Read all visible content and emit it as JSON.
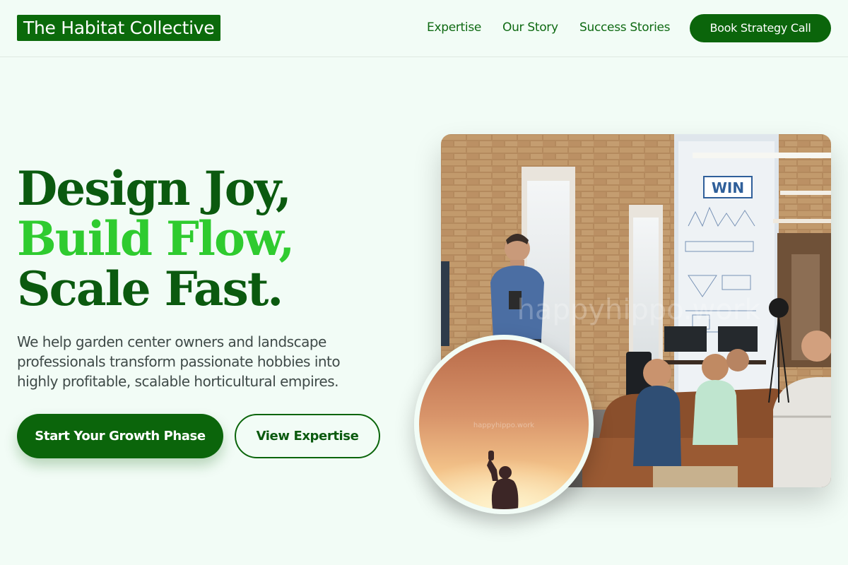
{
  "header": {
    "logo": "The Habitat Collective",
    "nav": [
      "Expertise",
      "Our Story",
      "Success Stories"
    ],
    "cta": "Book Strategy Call"
  },
  "hero": {
    "headline": [
      "Design Joy,",
      "Build Flow,",
      "Scale Fast."
    ],
    "subtext": "We help garden center owners and landscape professionals transform passionate hobbies into highly profitable, scalable horticultural empires.",
    "primary_button": "Start Your Growth Phase",
    "secondary_button": "View Expertise"
  },
  "images": {
    "main": "photo of a man presenting to a group seated on a leather couch in a brick-walled office",
    "circle": "photo of a silhouetted person raising a fist against a sunset sky",
    "watermark": "happyhippo.work"
  },
  "colors": {
    "brand_dark_green": "#0b650b",
    "accent_bright_green": "#2fcb2f",
    "background": "#f2fcf6",
    "body_text": "#3f4a48"
  }
}
